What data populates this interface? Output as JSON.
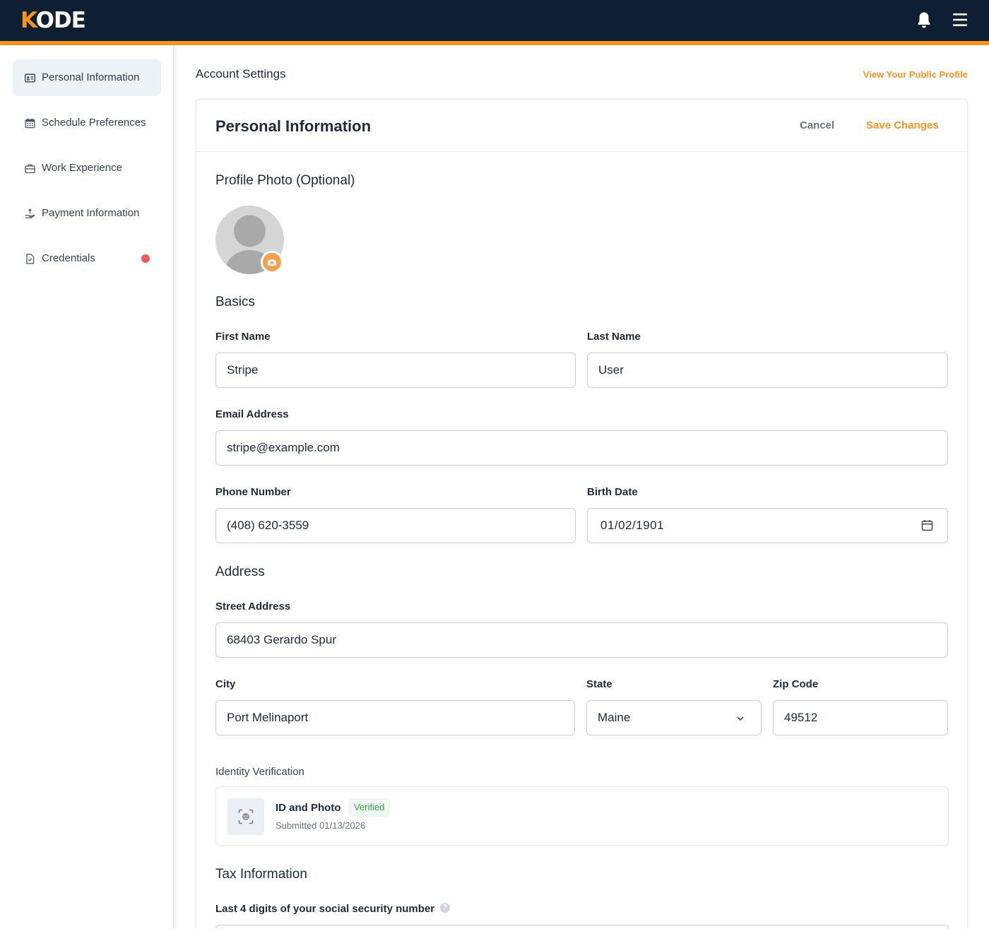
{
  "app": {
    "logo_first": "K",
    "logo_rest": "ODE"
  },
  "colors": {
    "accent": "#f7941d",
    "navy": "#0f1f33",
    "verified": "#3a9c4a",
    "alert": "#ef5b5b"
  },
  "topbar": {
    "icons": [
      "bell-icon",
      "menu-icon"
    ]
  },
  "sidebar": {
    "items": [
      {
        "label": "Personal Information",
        "icon": "id-card-icon",
        "active": true
      },
      {
        "label": "Schedule Preferences",
        "icon": "calendar-icon",
        "active": false
      },
      {
        "label": "Work Experience",
        "icon": "briefcase-icon",
        "active": false
      },
      {
        "label": "Payment Information",
        "icon": "hand-coin-icon",
        "active": false
      },
      {
        "label": "Credentials",
        "icon": "document-check-icon",
        "active": false,
        "alert": true
      }
    ]
  },
  "main": {
    "heading": "Account Settings",
    "public_profile_link": "View Your Public Profile",
    "card": {
      "title": "Personal Information",
      "cancel_label": "Cancel",
      "save_label": "Save Changes",
      "profile_photo_title": "Profile Photo (Optional)",
      "basics_title": "Basics",
      "fields": {
        "first_name": {
          "label": "First Name",
          "value": "Stripe"
        },
        "last_name": {
          "label": "Last Name",
          "value": "User"
        },
        "email": {
          "label": "Email Address",
          "value": "stripe@example.com"
        },
        "phone": {
          "label": "Phone Number",
          "value": "(408) 620-3559"
        },
        "birth_date": {
          "label": "Birth Date",
          "value": "01/02/1901"
        }
      },
      "address_title": "Address",
      "address": {
        "street": {
          "label": "Street Address",
          "value": "68403 Gerardo Spur"
        },
        "city": {
          "label": "City",
          "value": "Port Melinaport"
        },
        "state": {
          "label": "State",
          "value": "Maine"
        },
        "zip": {
          "label": "Zip Code",
          "value": "49512"
        }
      },
      "identity": {
        "label": "Identity Verification",
        "title": "ID and Photo",
        "status": "Verified",
        "submitted": "Submitted 01/13/2026"
      },
      "tax": {
        "title": "Tax Information",
        "ssn_label": "Last 4 digits of your social security number",
        "help_glyph": "?"
      }
    }
  }
}
